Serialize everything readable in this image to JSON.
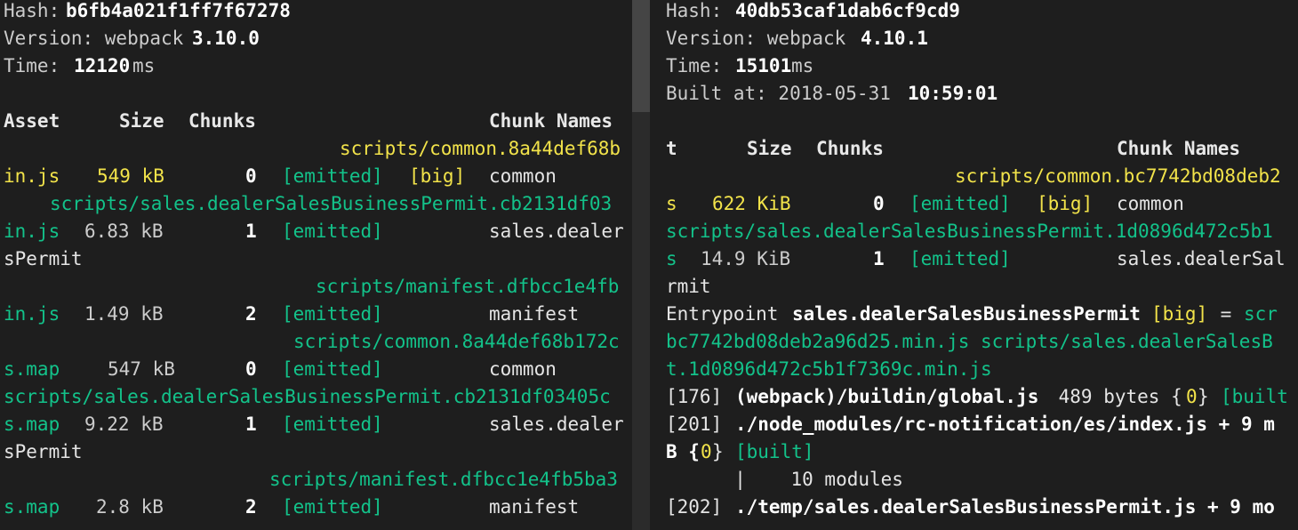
{
  "colors": {
    "background": "#1e1e1e",
    "text": "#cccccc",
    "green": "#13c28a",
    "yellow": "#f2e34a",
    "scrollbar": "#454545"
  },
  "left": {
    "hash_label": "Hash: ",
    "hash": "b6fb4a021f1ff7f67278",
    "version_label": "Version: webpack ",
    "version": "3.10.0",
    "time_label": "Time: ",
    "time": "12120",
    "time_unit": "ms",
    "headers": {
      "asset": "Asset",
      "size": "Size",
      "chunks": "Chunks",
      "names": "Chunk Names"
    },
    "rows": [
      {
        "name_line": "scripts/common.8a44def68b",
        "asset": "in.js",
        "size": "549 kB",
        "chunk": "0",
        "status": "[emitted]",
        "flag": "[big]",
        "chunk_name": "common",
        "extra": ""
      },
      {
        "name_line": "scripts/sales.dealerSalesBusinessPermit.cb2131df03",
        "asset": "in.js",
        "size": "6.83 kB",
        "chunk": "1",
        "status": "[emitted]",
        "flag": "",
        "chunk_name": "sales.dealer",
        "extra": "sPermit"
      },
      {
        "name_line": "scripts/manifest.dfbcc1e4fb",
        "asset": "in.js",
        "size": "1.49 kB",
        "chunk": "2",
        "status": "[emitted]",
        "flag": "",
        "chunk_name": "manifest",
        "extra": ""
      },
      {
        "name_line": "scripts/common.8a44def68b172c",
        "asset": "s.map",
        "size": "547 kB",
        "chunk": "0",
        "status": "[emitted]",
        "flag": "",
        "chunk_name": "common",
        "extra": ""
      },
      {
        "name_line": "scripts/sales.dealerSalesBusinessPermit.cb2131df03405c",
        "asset": "s.map",
        "size": "9.22 kB",
        "chunk": "1",
        "status": "[emitted]",
        "flag": "",
        "chunk_name": "sales.dealer",
        "extra": "sPermit"
      },
      {
        "name_line": "scripts/manifest.dfbcc1e4fb5ba3",
        "asset": "s.map",
        "size": "2.8 kB",
        "chunk": "2",
        "status": "[emitted]",
        "flag": "",
        "chunk_name": "manifest",
        "extra": ""
      }
    ]
  },
  "right": {
    "hash_label": "Hash: ",
    "hash": "40db53caf1dab6cf9cd9",
    "version_label": "Version: webpack ",
    "version": "4.10.1",
    "time_label": "Time: ",
    "time": "15101",
    "time_unit": "ms",
    "built_label": "Built at: 2018-05-31 ",
    "built_time": "10:59:01",
    "headers": {
      "asset": "t",
      "size": "Size",
      "chunks": "Chunks",
      "names": "Chunk Names"
    },
    "rows": [
      {
        "name_line": "scripts/common.bc7742bd08deb2",
        "asset": "s",
        "size": "622 KiB",
        "chunk": "0",
        "status": "[emitted]",
        "flag": "[big]",
        "chunk_name": "common",
        "extra": ""
      },
      {
        "name_line": "scripts/sales.dealerSalesBusinessPermit.1d0896d472c5b1",
        "asset": "s",
        "size": "14.9 KiB",
        "chunk": "1",
        "status": "[emitted]",
        "flag": "",
        "chunk_name": "sales.dealerSal",
        "extra": "rmit"
      }
    ],
    "entrypoint": {
      "label": "Entrypoint ",
      "name": "sales.dealerSalesBusinessPermit",
      "flag": "[big]",
      "eq": " = ",
      "first": "scr",
      "line2": "bc7742bd08deb2a96d25.min.js scripts/sales.dealerSalesB",
      "line3": "t.1d0896d472c5b1f7369c.min.js"
    },
    "modules": [
      {
        "id": "[176] ",
        "path": "(webpack)/buildin/global.js",
        "info": " 489 bytes {",
        "chunk": "0",
        "close": "} ",
        "status": "[built"
      },
      {
        "id": "[201] ",
        "path": "./node_modules/rc-notification/es/index.js + 9 m"
      },
      {
        "cont": "B {",
        "chunk": "0",
        "close": "} ",
        "status": "[built]"
      },
      {
        "tree": "  |    10 modules"
      },
      {
        "id": "[202] ",
        "path": "./temp/sales.dealerSalesBusinessPermit.js + 9 mo"
      }
    ]
  }
}
